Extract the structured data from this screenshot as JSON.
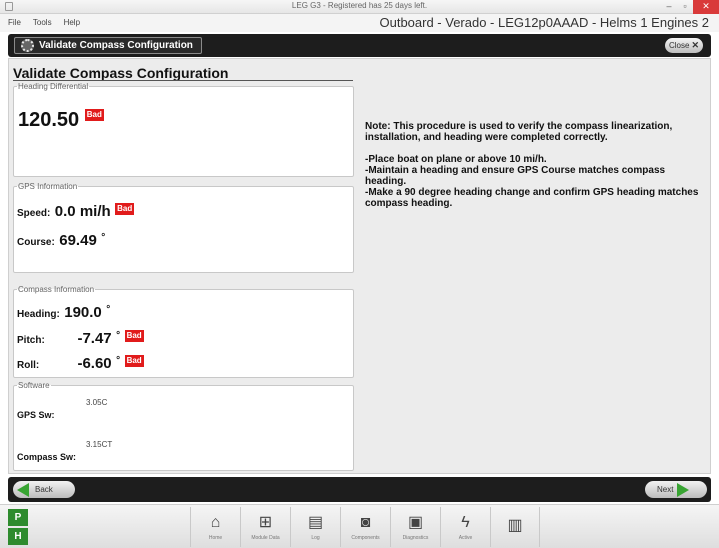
{
  "window": {
    "title": "LEG G3 - Registered has 25 days left."
  },
  "menu": {
    "items": [
      "File",
      "Tools",
      "Help"
    ],
    "engine_info": "Outboard - Verado - LEG12p0AAAD - Helms 1 Engines 2"
  },
  "header": {
    "tab_label": "Validate Compass Configuration",
    "close_label": "Close"
  },
  "page": {
    "title": "Validate Compass Configuration"
  },
  "heading_differential": {
    "legend": "Heading Differential",
    "value": "120.50",
    "status": "Bad"
  },
  "gps": {
    "legend": "GPS Information",
    "speed_label": "Speed:",
    "speed_value": "0.0 mi/h",
    "speed_status": "Bad",
    "course_label": "Course:",
    "course_value": "69.49",
    "course_unit": "°"
  },
  "compass": {
    "legend": "Compass Information",
    "heading_label": "Heading:",
    "heading_value": "190.0",
    "heading_unit": "°",
    "pitch_label": "Pitch:",
    "pitch_value": "-7.47",
    "pitch_unit": "°",
    "pitch_status": "Bad",
    "roll_label": "Roll:",
    "roll_value": "-6.60",
    "roll_unit": "°",
    "roll_status": "Bad"
  },
  "software": {
    "legend": "Software",
    "gps_label": "GPS Sw:",
    "gps_value": "3.05C",
    "compass_label": "Compass Sw:",
    "compass_value": "3.15CT"
  },
  "note": {
    "intro": "Note: This procedure is used to verify the compass linearization, installation, and heading were completed correctly.",
    "steps": [
      "-Place boat on plane or above 10 mi/h.",
      "-Maintain a heading and ensure GPS Course matches compass heading.",
      "-Make a 90 degree heading change and confirm GPS heading matches compass heading."
    ]
  },
  "nav": {
    "back_label": "Back",
    "next_label": "Next"
  },
  "toolbar": {
    "p_label": "P",
    "h_label": "H",
    "tools": [
      {
        "icon": "home-icon",
        "label": "Home"
      },
      {
        "icon": "modules-icon",
        "label": "Module Data"
      },
      {
        "icon": "clipboard-icon",
        "label": "Log"
      },
      {
        "icon": "component-icon",
        "label": "Components"
      },
      {
        "icon": "monitor-icon",
        "label": "Diagnostics"
      },
      {
        "icon": "lightning-icon",
        "label": "Active"
      },
      {
        "icon": "book-icon",
        "label": ""
      }
    ]
  },
  "colors": {
    "bad": "#e11b1b",
    "accent_green": "#38a432",
    "header_bg": "#1d1d1d"
  }
}
